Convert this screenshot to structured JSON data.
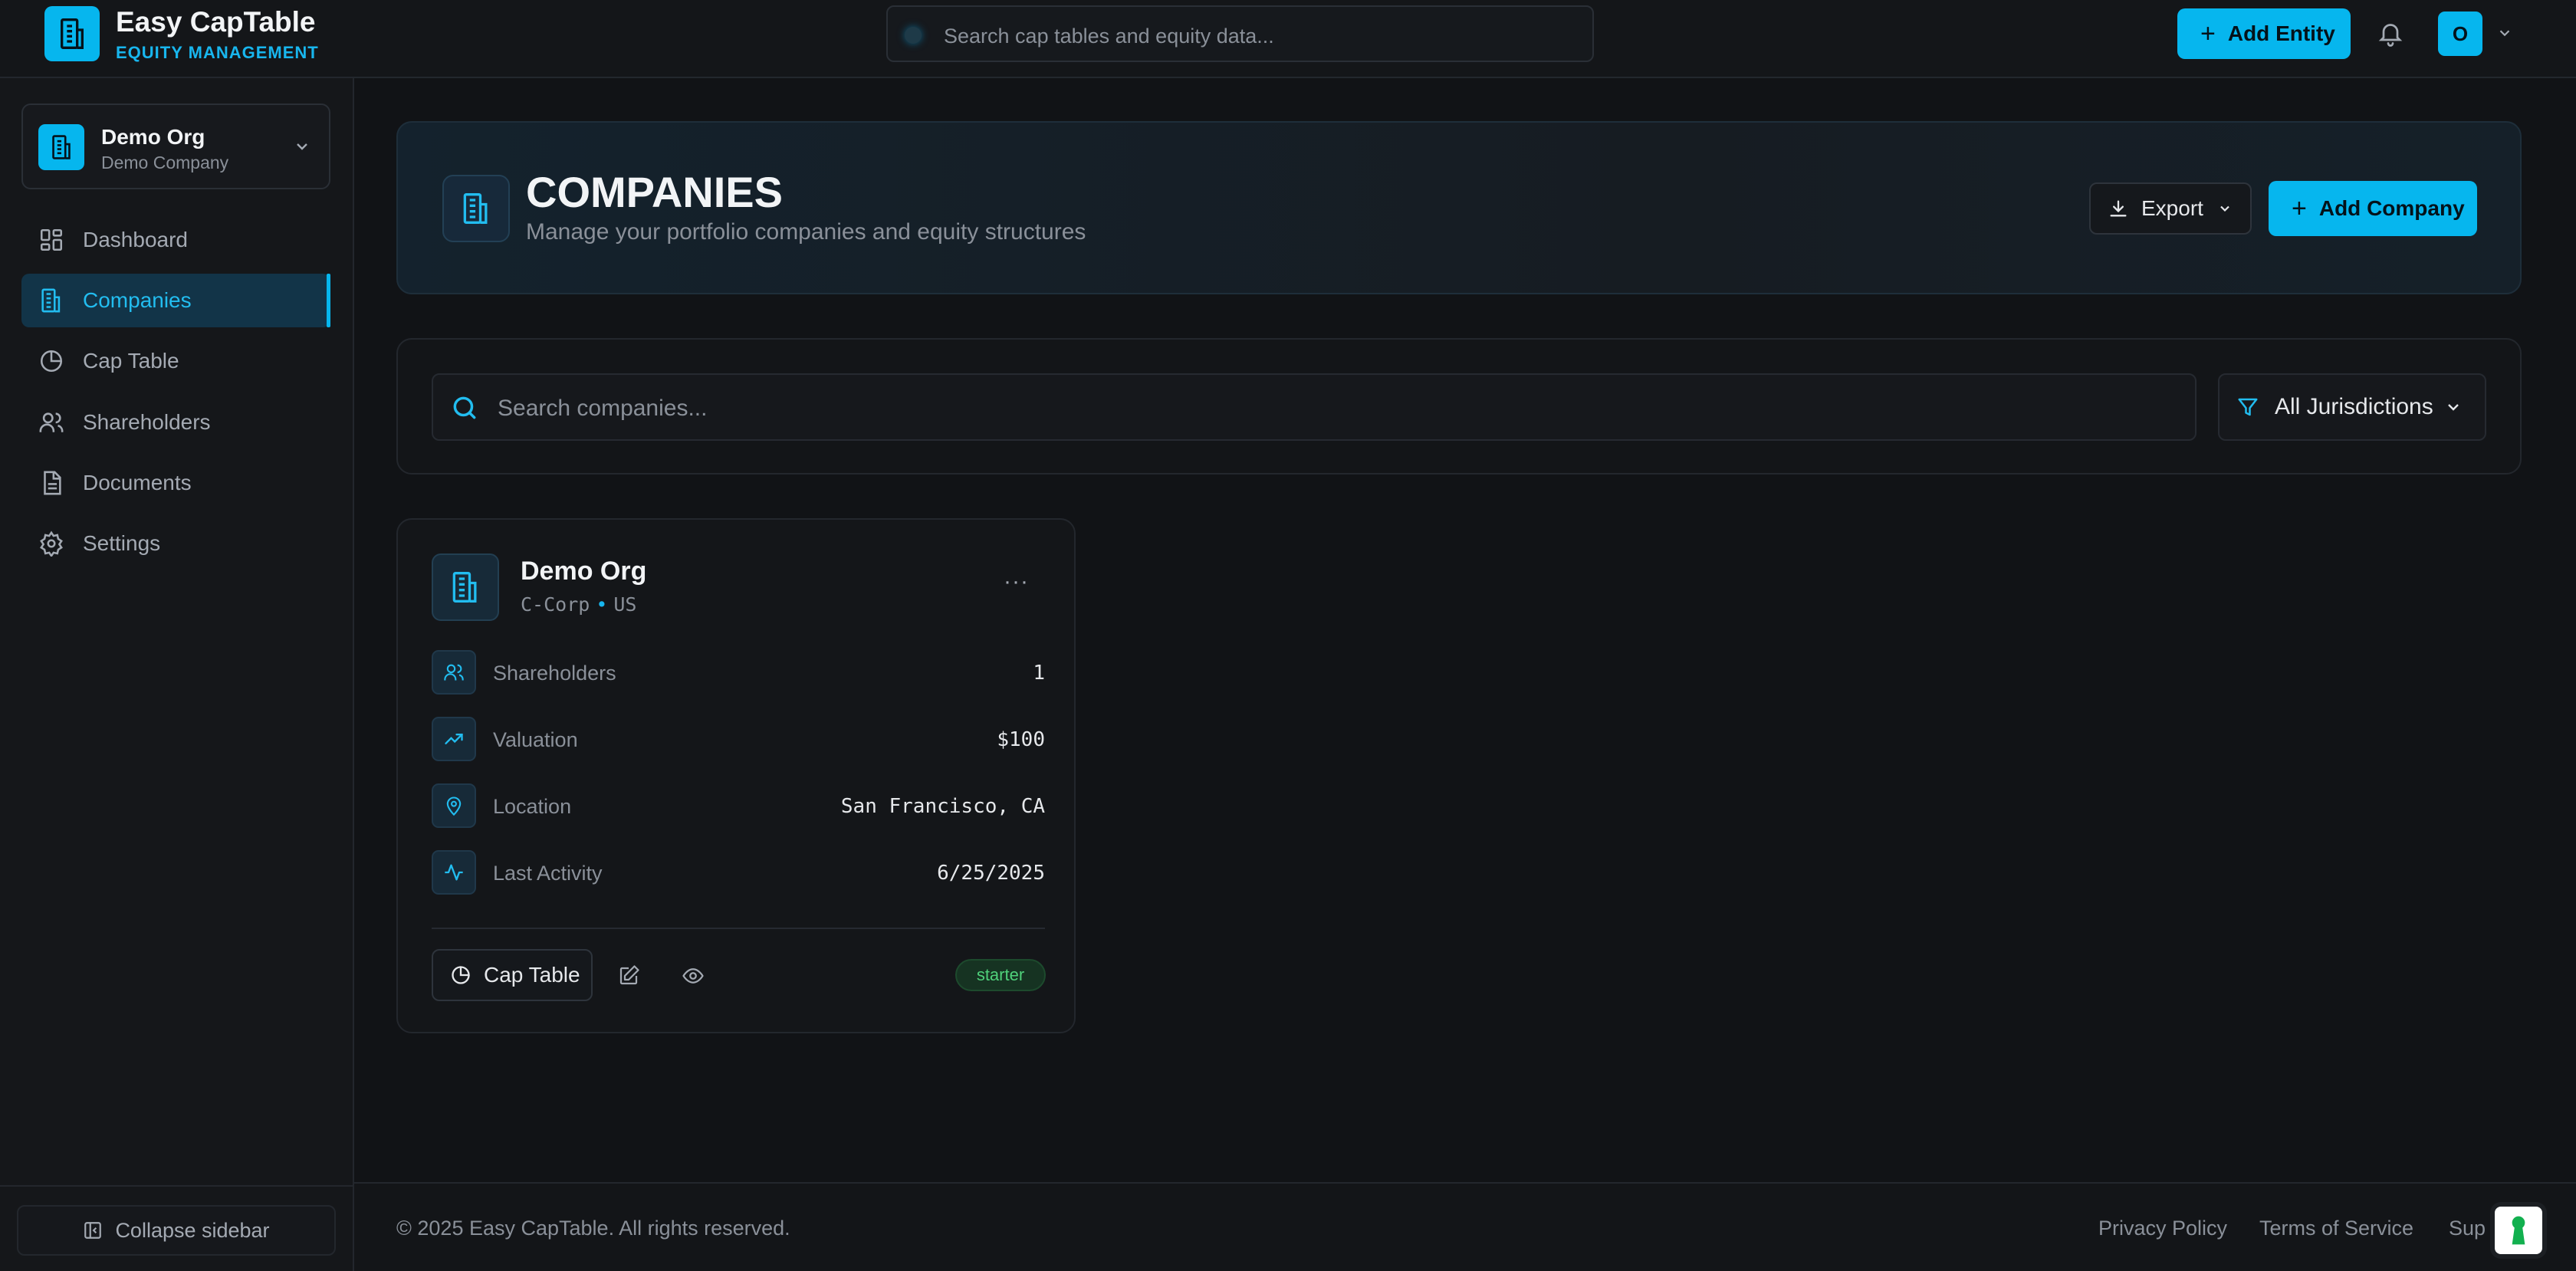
{
  "brand": {
    "title": "Easy CapTable",
    "subtitle": "EQUITY MANAGEMENT"
  },
  "header": {
    "search_placeholder": "Search cap tables and equity data...",
    "add_entity_label": "Add Entity",
    "avatar_initial": "O"
  },
  "org": {
    "name": "Demo Org",
    "sub": "Demo Company"
  },
  "sidebar": {
    "items": [
      {
        "label": "Dashboard",
        "icon": "dashboard-icon"
      },
      {
        "label": "Companies",
        "icon": "building-icon",
        "active": true
      },
      {
        "label": "Cap Table",
        "icon": "pie-chart-icon"
      },
      {
        "label": "Shareholders",
        "icon": "users-icon"
      },
      {
        "label": "Documents",
        "icon": "document-icon"
      },
      {
        "label": "Settings",
        "icon": "gear-icon"
      }
    ],
    "collapse_label": "Collapse sidebar"
  },
  "page": {
    "title": "COMPANIES",
    "subtitle": "Manage your portfolio companies and equity structures",
    "export_label": "Export",
    "add_company_label": "Add Company"
  },
  "filters": {
    "search_placeholder": "Search companies...",
    "jurisdiction_label": "All Jurisdictions"
  },
  "company_card": {
    "name": "Demo Org",
    "entity_type": "C-Corp",
    "country": "US",
    "more_label": "···",
    "stats": [
      {
        "label": "Shareholders",
        "value": "1",
        "icon": "users-icon"
      },
      {
        "label": "Valuation",
        "value": "$100",
        "icon": "trending-up-icon"
      },
      {
        "label": "Location",
        "value": "San Francisco, CA",
        "icon": "map-pin-icon"
      },
      {
        "label": "Last Activity",
        "value": "6/25/2025",
        "icon": "activity-icon"
      }
    ],
    "cap_table_label": "Cap Table",
    "plan": "starter"
  },
  "footer": {
    "copyright": "© 2025 Easy CapTable. All rights reserved.",
    "links": [
      "Privacy Policy",
      "Terms of Service",
      "Sup"
    ]
  },
  "colors": {
    "accent": "#06b6ee",
    "background": "#111316",
    "plan_badge": "#4fd07a"
  }
}
